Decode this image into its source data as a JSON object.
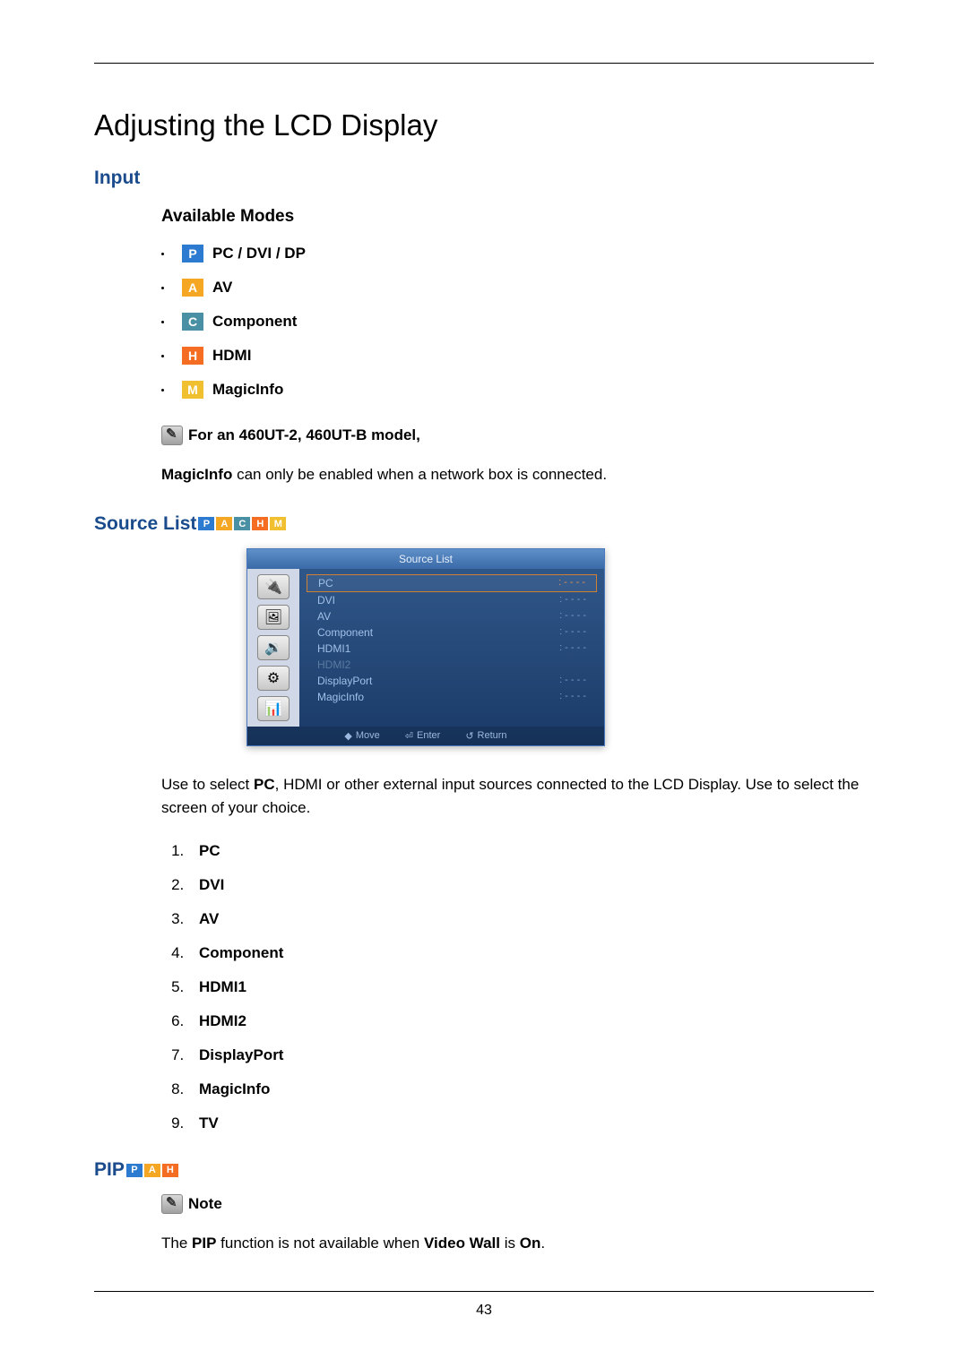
{
  "page_title": "Adjusting the LCD Display",
  "page_number": "43",
  "input_section": {
    "heading": "Input",
    "available_modes_heading": "Available Modes",
    "modes": [
      {
        "icon_letter": "P",
        "label": "PC / DVI / DP"
      },
      {
        "icon_letter": "A",
        "label": "AV"
      },
      {
        "icon_letter": "C",
        "label": "Component"
      },
      {
        "icon_letter": "H",
        "label": "HDMI"
      },
      {
        "icon_letter": "M",
        "label": "MagicInfo"
      }
    ],
    "model_note": "For an 460UT-2, 460UT-B model,",
    "magicinfo_text_bold": "MagicInfo",
    "magicinfo_text_rest": " can only be enabled when a network box is connected."
  },
  "source_list_section": {
    "heading": "Source List",
    "osd_title": "Source List",
    "rows": [
      {
        "label": "PC",
        "status": ": - - - -",
        "selected": true,
        "disabled": false
      },
      {
        "label": "DVI",
        "status": ": - - - -",
        "selected": false,
        "disabled": false
      },
      {
        "label": "AV",
        "status": ": - - - -",
        "selected": false,
        "disabled": false
      },
      {
        "label": "Component",
        "status": ": - - - -",
        "selected": false,
        "disabled": false
      },
      {
        "label": "HDMI1",
        "status": ": - - - -",
        "selected": false,
        "disabled": false
      },
      {
        "label": "HDMI2",
        "status": "",
        "selected": false,
        "disabled": true
      },
      {
        "label": "DisplayPort",
        "status": ": - - - -",
        "selected": false,
        "disabled": false
      },
      {
        "label": "MagicInfo",
        "status": ": - - - -",
        "selected": false,
        "disabled": false
      }
    ],
    "footer": {
      "move": "Move",
      "enter": "Enter",
      "return": "Return"
    },
    "description_pre": "Use to select ",
    "description_bold": "PC",
    "description_rest": ", HDMI or other external input sources connected to the LCD Display. Use to select the screen of your choice.",
    "items": [
      "PC",
      "DVI",
      "AV",
      "Component",
      "HDMI1",
      "HDMI2",
      "DisplayPort",
      "MagicInfo",
      "TV"
    ]
  },
  "pip_section": {
    "heading": "PIP",
    "note_label": "Note",
    "note_pre": "The ",
    "note_bold1": "PIP",
    "note_mid": " function is not available when ",
    "note_bold2": "Video Wall",
    "note_mid2": " is ",
    "note_bold3": "On",
    "note_end": "."
  }
}
